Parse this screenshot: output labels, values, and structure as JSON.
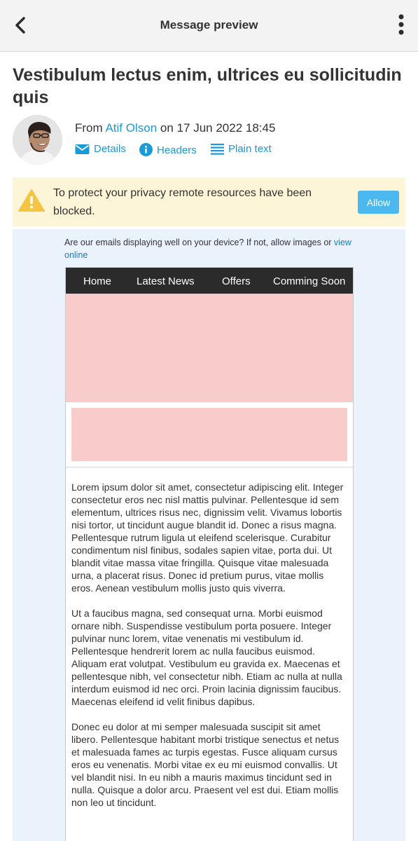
{
  "topbar": {
    "title": "Message preview",
    "back_icon": "chevron-left-icon",
    "more_icon": "more-vertical-icon"
  },
  "message": {
    "subject": "Vestibulum lectus enim, ultrices eu sollicitudin quis",
    "from_label": "From",
    "sender_name": "Atif Olson",
    "on_label": "on",
    "date": "17 Jun 2022 18:45"
  },
  "actions": {
    "details": "Details",
    "headers": "Headers",
    "plain_text": "Plain text"
  },
  "privacy": {
    "text": "To protect your privacy remote resources have been blocked.",
    "allow_label": "Allow"
  },
  "email": {
    "preheader_text": "Are our emails displaying well on your device? If not, allow images or",
    "preheader_link": "view online",
    "nav": [
      "Home",
      "Latest News",
      "Offers",
      "Comming Soon"
    ],
    "paragraphs": [
      "Lorem ipsum dolor sit amet, consectetur adipiscing elit. Integer consectetur eros nec nisl mattis pulvinar. Pellentesque id sem elementum, ultrices risus nec, dignissim velit. Vivamus lobortis nisi tortor, ut tincidunt augue blandit id. Donec a risus magna. Pellentesque rutrum ligula ut eleifend scelerisque. Curabitur condimentum nisl finibus, sodales sapien vitae, porta dui. Ut blandit vitae massa vitae fringilla. Quisque vitae malesuada urna, a placerat risus. Donec id pretium purus, vitae mollis eros. Aenean vestibulum mollis justo quis viverra.",
      "Ut a faucibus magna, sed consequat urna. Morbi euismod ornare nibh. Suspendisse vestibulum porta posuere. Integer pulvinar nunc lorem, vitae venenatis mi vestibulum id. Pellentesque hendrerit lorem ac nulla faucibus euismod. Aliquam erat volutpat. Vestibulum eu gravida ex. Maecenas et pellentesque nibh, vel consectetur nibh. Etiam ac nulla at nulla interdum euismod id nec orci. Proin lacinia dignissim faucibus. Maecenas eleifend id velit finibus dapibus.",
      "Donec eu dolor at mi semper malesuada suscipit sit amet libero. Pellentesque habitant morbi tristique senectus et netus et malesuada fames ac turpis egestas. Fusce aliquam cursus eros eu venenatis. Morbi vitae ex eu mi euismod convallis. Ut vel blandit nisi. In eu nibh a mauris maximus tincidunt sed in nulla. Quisque a dolor arcu. Praesent vel est dui. Etiam mollis non leo ut tincidunt."
    ]
  },
  "colors": {
    "link": "#1a9ad6",
    "banner_bg": "#fdf5d8",
    "warning": "#f5c542",
    "allow_button": "#4cb8f0",
    "email_bg": "#eaf3fc",
    "email_nav": "#2b2b2b",
    "image_placeholder": "#f9cccc"
  }
}
